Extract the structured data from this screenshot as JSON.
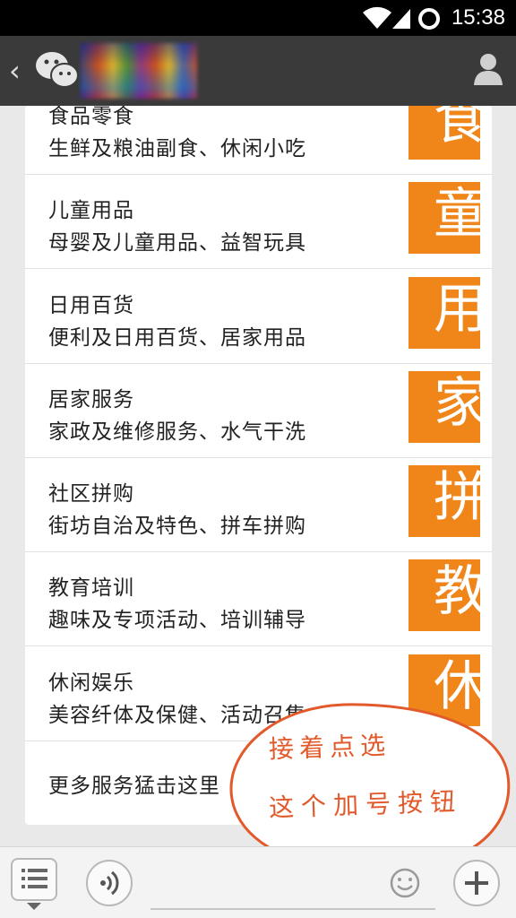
{
  "status_bar": {
    "time": "15:38"
  },
  "header": {
    "back_icon": "chevron-left-icon",
    "app_icon": "wechat-icon",
    "profile_icon": "person-icon"
  },
  "menu_rows": [
    {
      "title": "食品零食",
      "subtitle": "生鲜及粮油副食、休闲小吃",
      "tile_char": "食"
    },
    {
      "title": "儿童用品",
      "subtitle": "母婴及儿童用品、益智玩具",
      "tile_char": "童"
    },
    {
      "title": "日用百货",
      "subtitle": "便利及日用百货、居家用品",
      "tile_char": "用"
    },
    {
      "title": "居家服务",
      "subtitle": "家政及维修服务、水气干洗",
      "tile_char": "家"
    },
    {
      "title": "社区拼购",
      "subtitle": "街坊自治及特色、拼车拼购",
      "tile_char": "拼"
    },
    {
      "title": "教育培训",
      "subtitle": "趣味及专项活动、培训辅导",
      "tile_char": "教"
    },
    {
      "title": "休闲娱乐",
      "subtitle": "美容纤体及保健、活动召集",
      "tile_char": "休"
    }
  ],
  "more_row": {
    "title": "更多服务猛击这里"
  },
  "callout": {
    "line1": "接着点选",
    "line2": "这个加号按钮"
  },
  "colors": {
    "tile_orange": "#f08519",
    "callout_text": "#e25a2b",
    "header_bg": "#3a3a3a"
  }
}
